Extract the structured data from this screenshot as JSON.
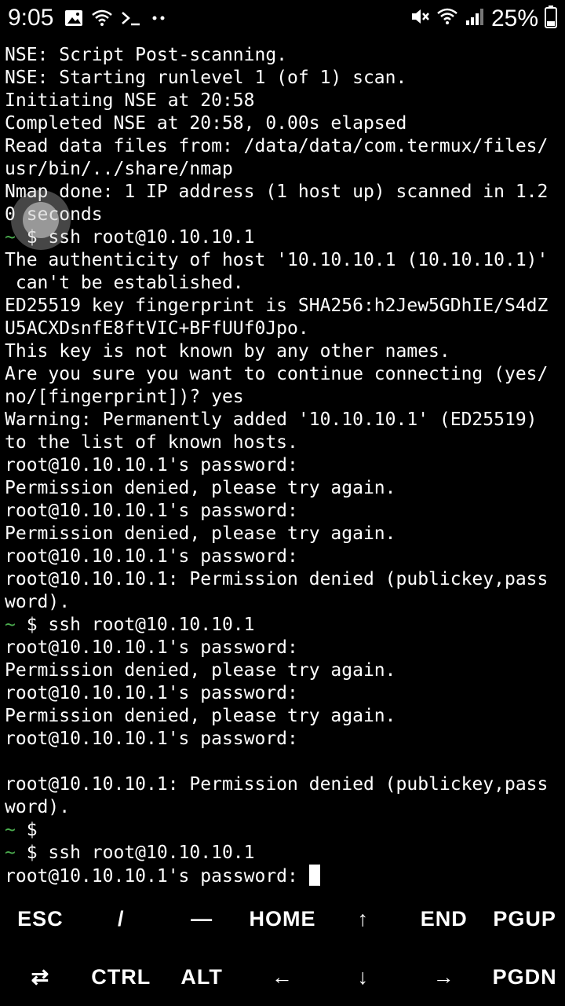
{
  "status_bar": {
    "time": "9:05",
    "left_icons": [
      "image-icon",
      "wifi-icon",
      "terminal-icon",
      "more-dots-icon"
    ],
    "right_icons": [
      "mute-icon",
      "wifi-icon",
      "signal-icon"
    ],
    "battery": "25%"
  },
  "terminal": {
    "lines": [
      "NSE: Script Post-scanning.",
      "NSE: Starting runlevel 1 (of 1) scan.",
      "Initiating NSE at 20:58",
      "Completed NSE at 20:58, 0.00s elapsed",
      "Read data files from: /data/data/com.termux/files/",
      "usr/bin/../share/nmap",
      "Nmap done: 1 IP address (1 host up) scanned in 1.2",
      "0 seconds",
      "~ $ ssh root@10.10.10.1",
      "The authenticity of host '10.10.10.1 (10.10.10.1)'",
      " can't be established.",
      "ED25519 key fingerprint is SHA256:h2Jew5GDhIE/S4dZ",
      "U5ACXDsnfE8ftVIC+BFfUUf0Jpo.",
      "This key is not known by any other names.",
      "Are you sure you want to continue connecting (yes/",
      "no/[fingerprint])? yes",
      "Warning: Permanently added '10.10.10.1' (ED25519)",
      "to the list of known hosts.",
      "root@10.10.10.1's password:",
      "Permission denied, please try again.",
      "root@10.10.10.1's password:",
      "Permission denied, please try again.",
      "root@10.10.10.1's password:",
      "root@10.10.10.1: Permission denied (publickey,pass",
      "word).",
      "~ $ ssh root@10.10.10.1",
      "root@10.10.10.1's password:",
      "Permission denied, please try again.",
      "root@10.10.10.1's password:",
      "Permission denied, please try again.",
      "root@10.10.10.1's password:",
      "",
      "root@10.10.10.1: Permission denied (publickey,pass",
      "word).",
      "~ $",
      "~ $ ssh root@10.10.10.1",
      "root@10.10.10.1's password: "
    ],
    "prompt_color": "#4caf50"
  },
  "extra_keys": {
    "row1": [
      "ESC",
      "/",
      "—",
      "HOME",
      "↑",
      "END",
      "PGUP"
    ],
    "row2": [
      "⇄",
      "CTRL",
      "ALT",
      "←",
      "↓",
      "→",
      "PGDN"
    ]
  }
}
